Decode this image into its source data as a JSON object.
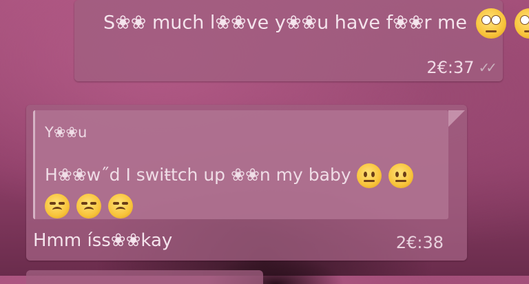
{
  "outgoing_message": {
    "text": "S❀❀ much l❀❀ve y❀❀u have f❀❀r me",
    "emojis": [
      "eye-roll-emoji",
      "eye-roll-emoji"
    ],
    "time": "2€:37",
    "status": "double-check"
  },
  "incoming_message": {
    "quoted": {
      "sender": "Y❀❀u",
      "text": "H❀❀w˝d I swiŧtch up ❀❀n my baby",
      "emojis": [
        "neutral-face-emoji",
        "neutral-face-emoji",
        "unamused-face-emoji",
        "unamused-face-emoji",
        "unamused-face-emoji"
      ]
    },
    "text": "Hmm íss❀❀kay",
    "time": "2€:38"
  }
}
